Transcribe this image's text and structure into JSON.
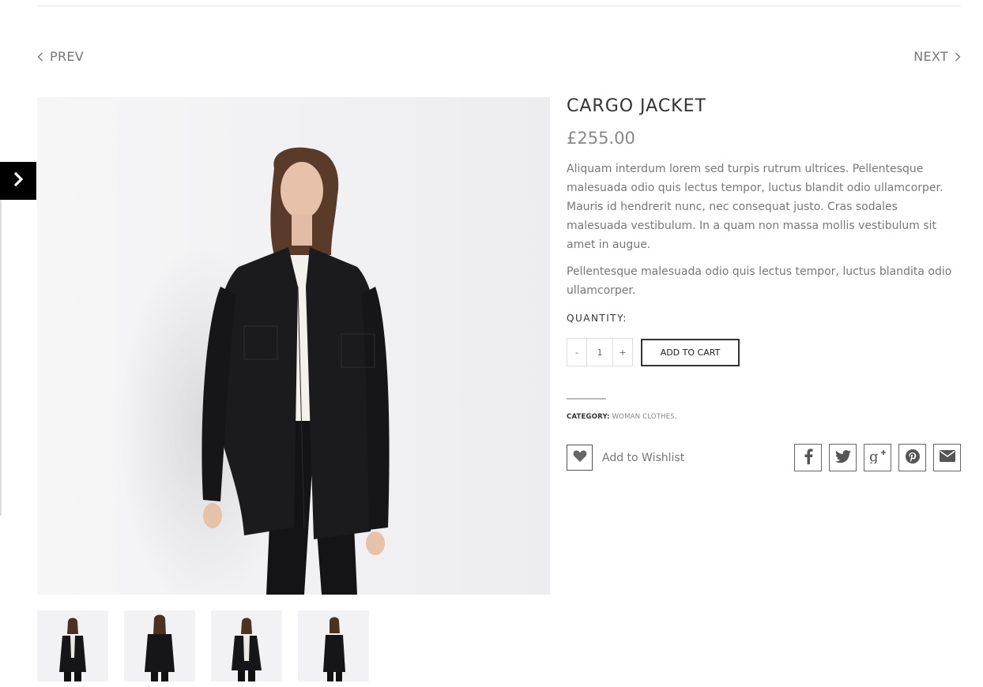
{
  "navigation": {
    "prev_label": "PREV",
    "next_label": "NEXT"
  },
  "product": {
    "title": "CARGO JACKET",
    "price": "£255.00",
    "description": [
      "Aliquam interdum lorem sed turpis rutrum ultrices. Pellentesque malesuada odio quis lectus tempor, luctus blandit odio ullamcorper. Mauris id hendrerit nunc, nec consequat justo. Cras sodales malesuada vestibulum. In a quam non massa mollis vestibulum sit amet in augue.",
      "Pellentesque malesuada odio quis lectus tempor, luctus blandita odio ullamcorper."
    ],
    "quantity_label": "QUANTITY:",
    "quantity_minus": "-",
    "quantity_value": "1",
    "quantity_plus": "+",
    "add_to_cart_label": "ADD TO CART",
    "category_label": "CATEGORY:",
    "category_value": "WOMAN CLOTHES",
    "category_suffix": ".",
    "wishlist_label": "Add to Wishlist"
  },
  "gallery": {
    "thumbnails": [
      "front view",
      "back view",
      "front open view",
      "side view"
    ]
  },
  "share_icons": [
    "facebook-icon",
    "twitter-icon",
    "google-plus-icon",
    "pinterest-icon",
    "email-icon"
  ],
  "colors": {
    "accent": "#000000",
    "text": "#777777",
    "heading": "#333333",
    "image_background": "#f1f1f3"
  }
}
